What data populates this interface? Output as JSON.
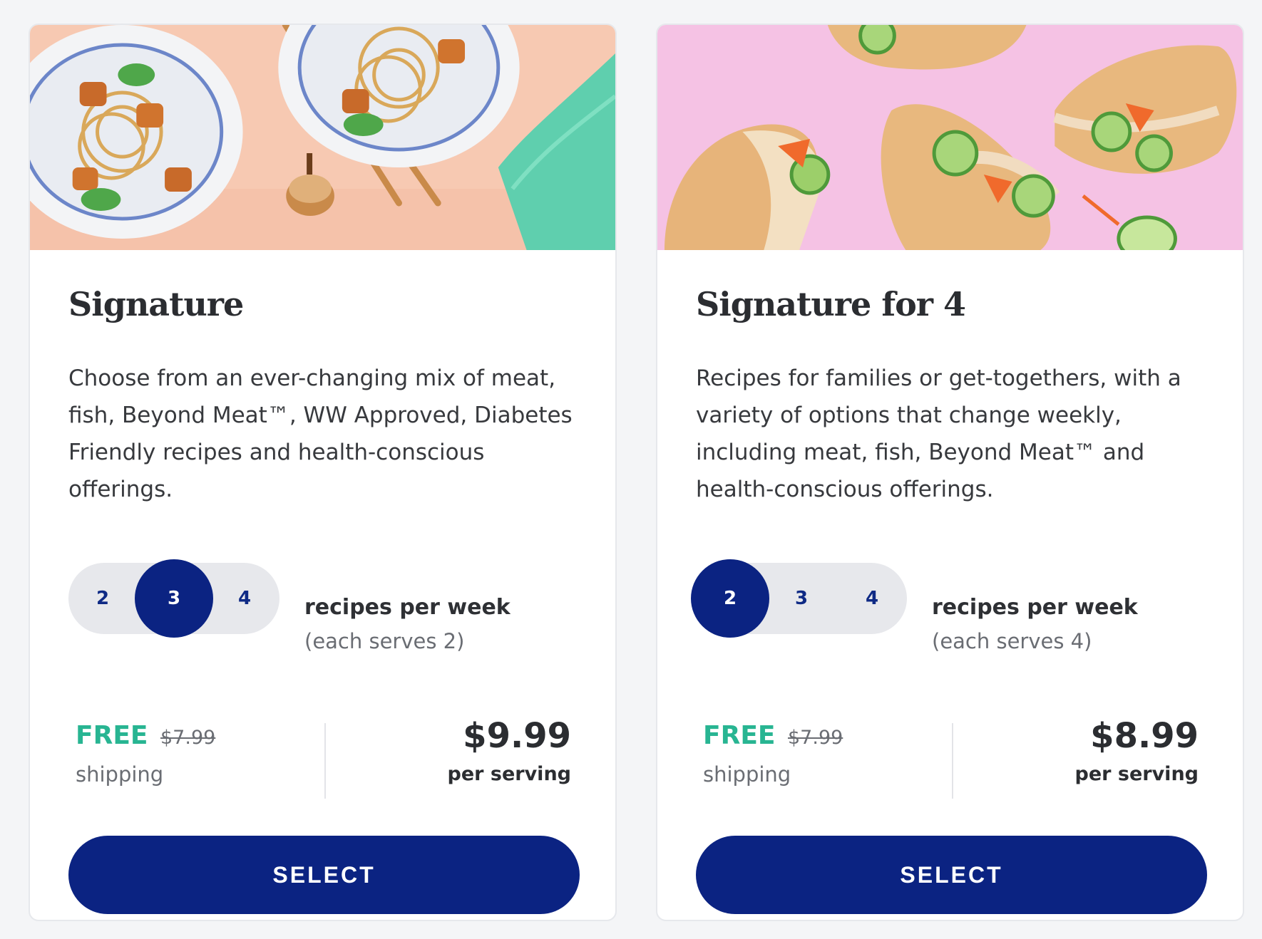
{
  "colors": {
    "accent": "#0b2382",
    "free": "#28b592",
    "pill_bg": "#e7e8ec"
  },
  "plans": [
    {
      "title": "Signature",
      "description": "Choose from an ever-changing mix of meat, fish, Beyond Meat™, WW Approved, Diabetes Friendly recipes and health-conscious offerings.",
      "recipe_options": [
        "2",
        "3",
        "4"
      ],
      "selected_recipes": "3",
      "selector_label": "recipes per week",
      "selector_sublabel": "(each serves 2)",
      "free_label": "FREE",
      "original_shipping": "$7.99",
      "shipping_label": "shipping",
      "price": "$9.99",
      "price_unit": "per serving",
      "button_label": "SELECT"
    },
    {
      "title": "Signature for 4",
      "description": "Recipes for families or get-togethers, with a variety of options that change weekly, including meat, fish, Beyond Meat™ and health-conscious offerings.",
      "recipe_options": [
        "2",
        "3",
        "4"
      ],
      "selected_recipes": "2",
      "selector_label": "recipes per week",
      "selector_sublabel": "(each serves 4)",
      "free_label": "FREE",
      "original_shipping": "$7.99",
      "shipping_label": "shipping",
      "price": "$8.99",
      "price_unit": "per serving",
      "button_label": "SELECT"
    }
  ]
}
